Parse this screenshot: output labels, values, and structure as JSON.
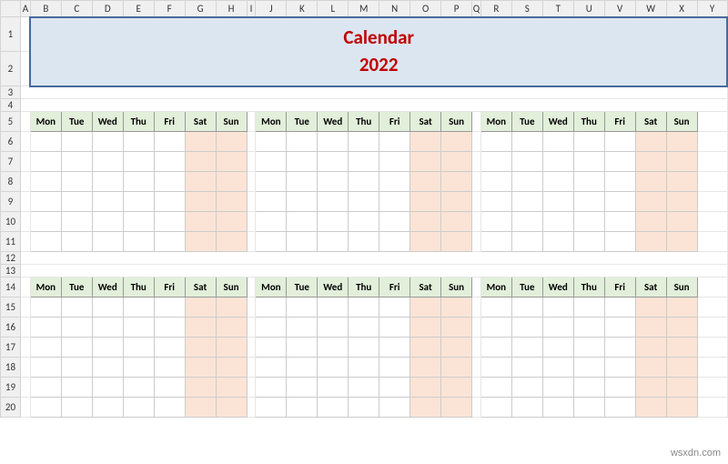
{
  "columns": [
    "A",
    "B",
    "C",
    "D",
    "E",
    "F",
    "G",
    "H",
    "I",
    "J",
    "K",
    "L",
    "M",
    "N",
    "O",
    "P",
    "Q",
    "R",
    "S",
    "T",
    "U",
    "V",
    "W",
    "X",
    "Y"
  ],
  "rows": [
    "1",
    "2",
    "3",
    "4",
    "5",
    "6",
    "7",
    "8",
    "9",
    "10",
    "11",
    "12",
    "13",
    "14",
    "15",
    "16",
    "17",
    "18",
    "19",
    "20"
  ],
  "title": {
    "line1": "Calendar",
    "line2": "2022"
  },
  "days": [
    "Mon",
    "Tue",
    "Wed",
    "Thu",
    "Fri",
    "Sat",
    "Sun"
  ],
  "watermark": "wsxdn.com"
}
